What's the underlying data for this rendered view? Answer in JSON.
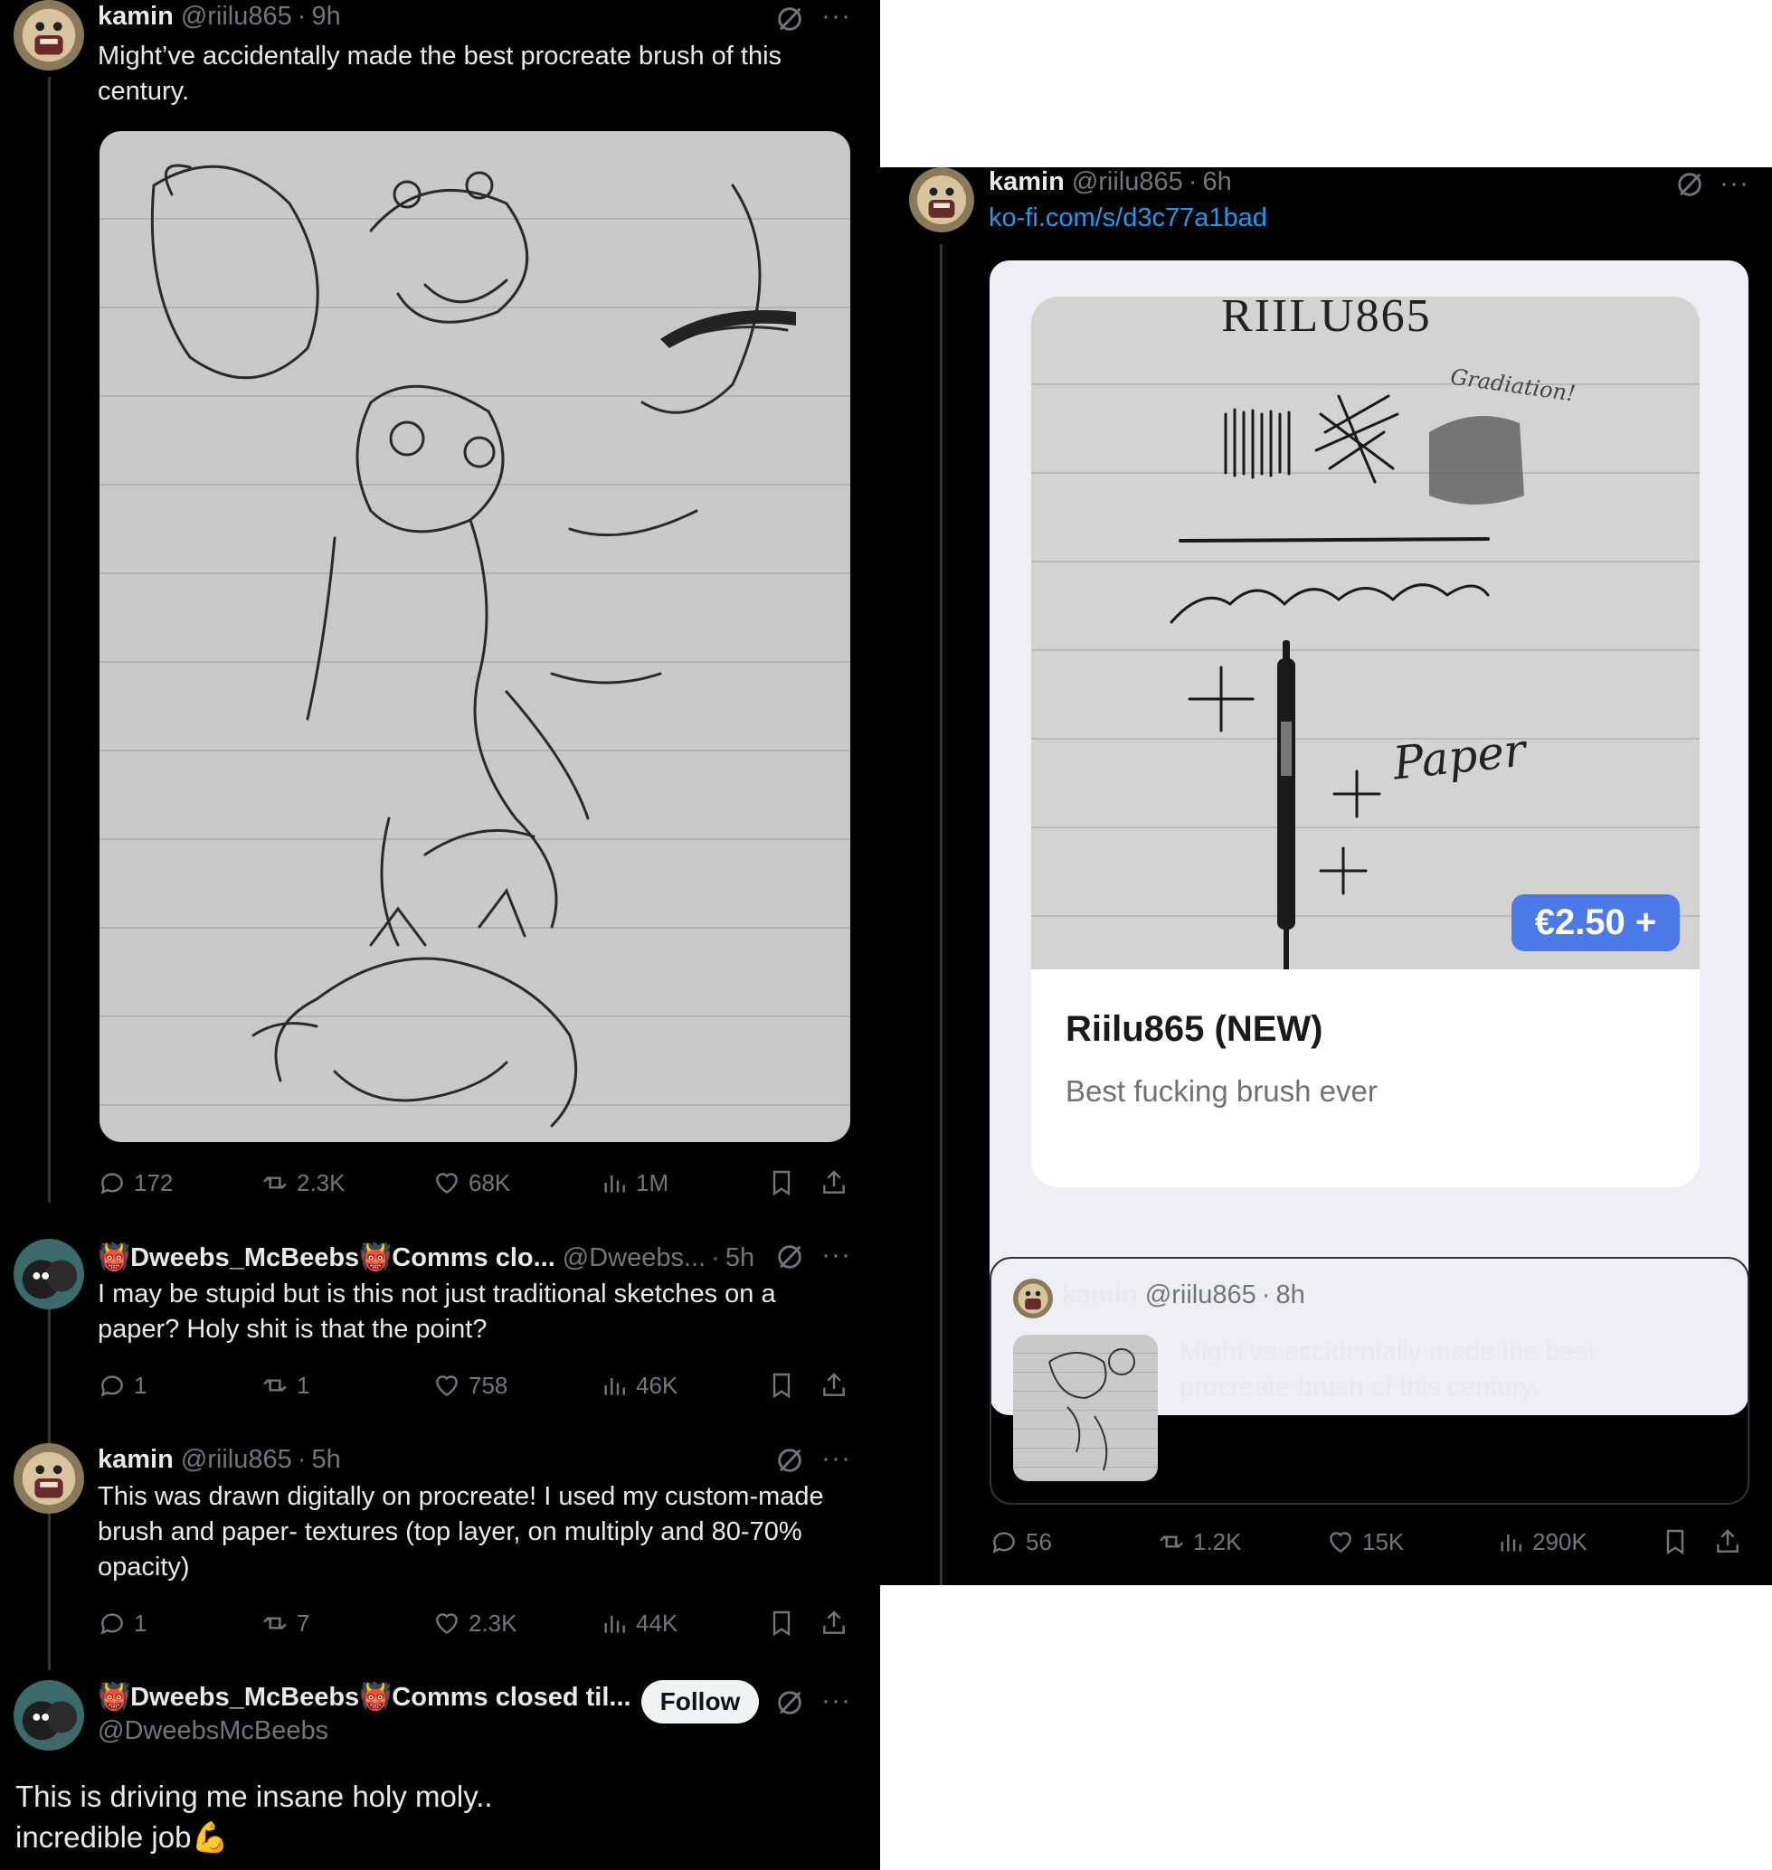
{
  "colors": {
    "accent": "#1d9bf0",
    "muted": "#71767b",
    "price_badge": "#4b7ae8"
  },
  "left": {
    "post1": {
      "name": "kamin",
      "handle": "@riilu865",
      "time": "9h",
      "text": "Might’ve accidentally made the best procreate brush of this century.",
      "stats": {
        "replies": "172",
        "reposts": "2.3K",
        "likes": "68K",
        "views": "1M"
      }
    },
    "reply1": {
      "name": "Dweebs_McBeebs",
      "name_suffix": "Comms clo...",
      "handle": "@Dweebs...",
      "time": "5h",
      "text": "I may be stupid but is this not just traditional sketches on a paper? Holy shit is that the point?",
      "stats": {
        "replies": "1",
        "reposts": "1",
        "likes": "758",
        "views": "46K"
      }
    },
    "reply2": {
      "name": "kamin",
      "handle": "@riilu865",
      "time": "5h",
      "text": "This was drawn digitally on procreate! I used my custom-made brush and paper- textures (top layer, on multiply and 80-70% opacity)",
      "stats": {
        "replies": "1",
        "reposts": "7",
        "likes": "2.3K",
        "views": "44K"
      }
    },
    "reply3": {
      "name": "Dweebs_McBeebs",
      "name_suffix": "Comms closed til...",
      "handle": "@DweebsMcBeebs",
      "follow_label": "Follow",
      "text_line1": "This is driving me insane holy moly..",
      "text_line2": "incredible job",
      "emoji": "💪"
    }
  },
  "right": {
    "post": {
      "name": "kamin",
      "handle": "@riilu865",
      "time": "6h",
      "link": "ko-fi.com/s/d3c77a1bad",
      "stats": {
        "replies": "56",
        "reposts": "1.2K",
        "likes": "15K",
        "views": "290K"
      }
    },
    "kofi": {
      "title": "Riilu865 (NEW)",
      "subtitle": "Best fucking brush ever",
      "price": "€2.50 +",
      "image_text": {
        "header": "RIILU865",
        "gradiation": "Gradiation!",
        "paper": "Paper"
      }
    },
    "quote": {
      "name": "kamin",
      "handle": "@riilu865",
      "time": "8h",
      "text": "Might’ve accidentally made the best procreate brush of this century."
    }
  }
}
